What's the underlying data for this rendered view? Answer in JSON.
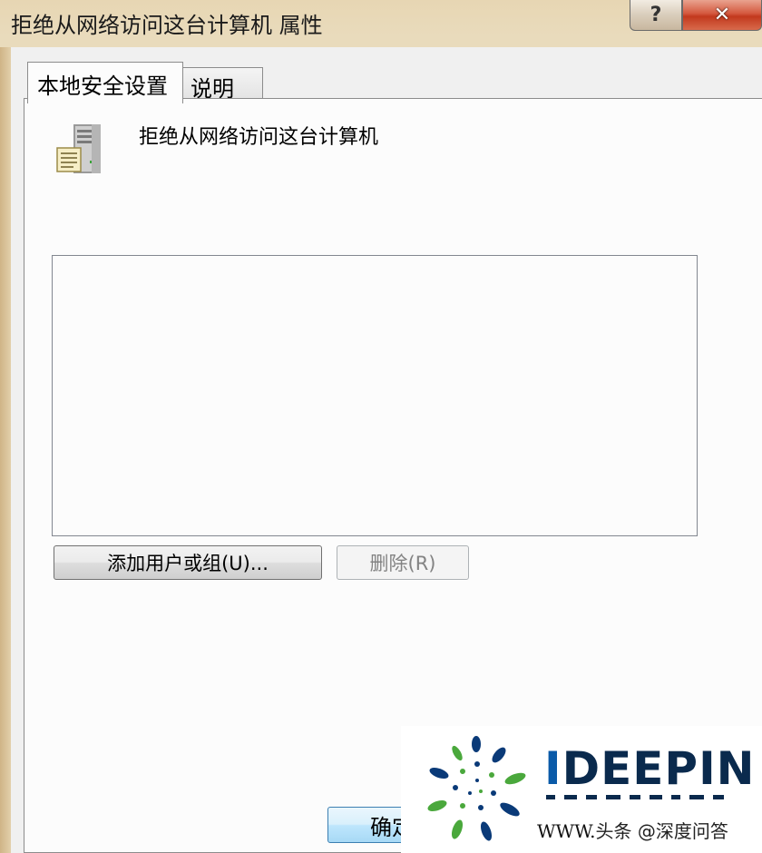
{
  "window": {
    "title": "拒绝从网络访问这台计算机 属性",
    "help_label": "?",
    "close_label": "✕"
  },
  "tabs": [
    {
      "label": "本地安全设置",
      "active": true
    },
    {
      "label": "说明",
      "active": false
    }
  ],
  "policy": {
    "icon": "server-policy-icon",
    "name": "拒绝从网络访问这台计算机"
  },
  "user_list": {
    "items": []
  },
  "buttons": {
    "add_label": "添加用户或组(U)...",
    "remove_label": "删除(R)",
    "ok_label": "确定"
  },
  "watermark": {
    "brand_prefix": "I",
    "brand_rest": "DEEPIN",
    "site": "WWW.",
    "source": "头条 @深度问答"
  },
  "colors": {
    "title_bar": "#e8d9b9",
    "close_button": "#c2391d",
    "ok_button_border": "#3c7fb1",
    "brand_dark": "#0a2a4d",
    "brand_blue": "#0a5aa8",
    "logo_green": "#4aa83c"
  }
}
